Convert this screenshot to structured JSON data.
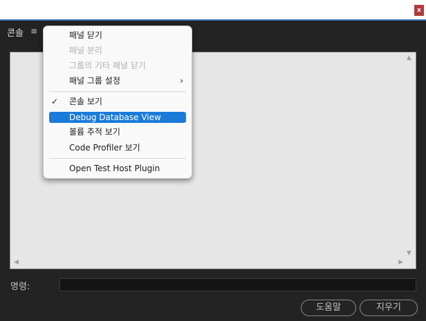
{
  "window": {
    "close_label": "x"
  },
  "panel": {
    "tab_label": "콘솔",
    "menu_icon": "≡"
  },
  "output": {
    "scroll_up": "▲",
    "scroll_down": "▼",
    "scroll_left": "◀",
    "scroll_right": "▶"
  },
  "command": {
    "label": "명령:",
    "value": ""
  },
  "footer": {
    "help_label": "도움말",
    "clear_label": "지우기"
  },
  "menu": {
    "items": [
      {
        "label": "패널 닫기",
        "enabled": true
      },
      {
        "label": "패널 분리",
        "enabled": false
      },
      {
        "label": "그룹의 기타 패널 닫기",
        "enabled": false
      },
      {
        "label": "패널 그룹 설정",
        "enabled": true,
        "submenu_icon": "›"
      },
      {
        "label": "콘솔 보기",
        "enabled": true,
        "check_icon": "✓"
      },
      {
        "label": "Debug Database View",
        "enabled": true,
        "highlighted": true
      },
      {
        "label": "볼륨 추적 보기",
        "enabled": true
      },
      {
        "label": "Code Profiler 보기",
        "enabled": true
      },
      {
        "label": "Open Test Host Plugin",
        "enabled": true
      }
    ]
  },
  "colors": {
    "background": "#232323",
    "menu_highlight": "#1a7bd9",
    "title_accent": "#3b6fb6",
    "close_button": "#b33a3a"
  }
}
